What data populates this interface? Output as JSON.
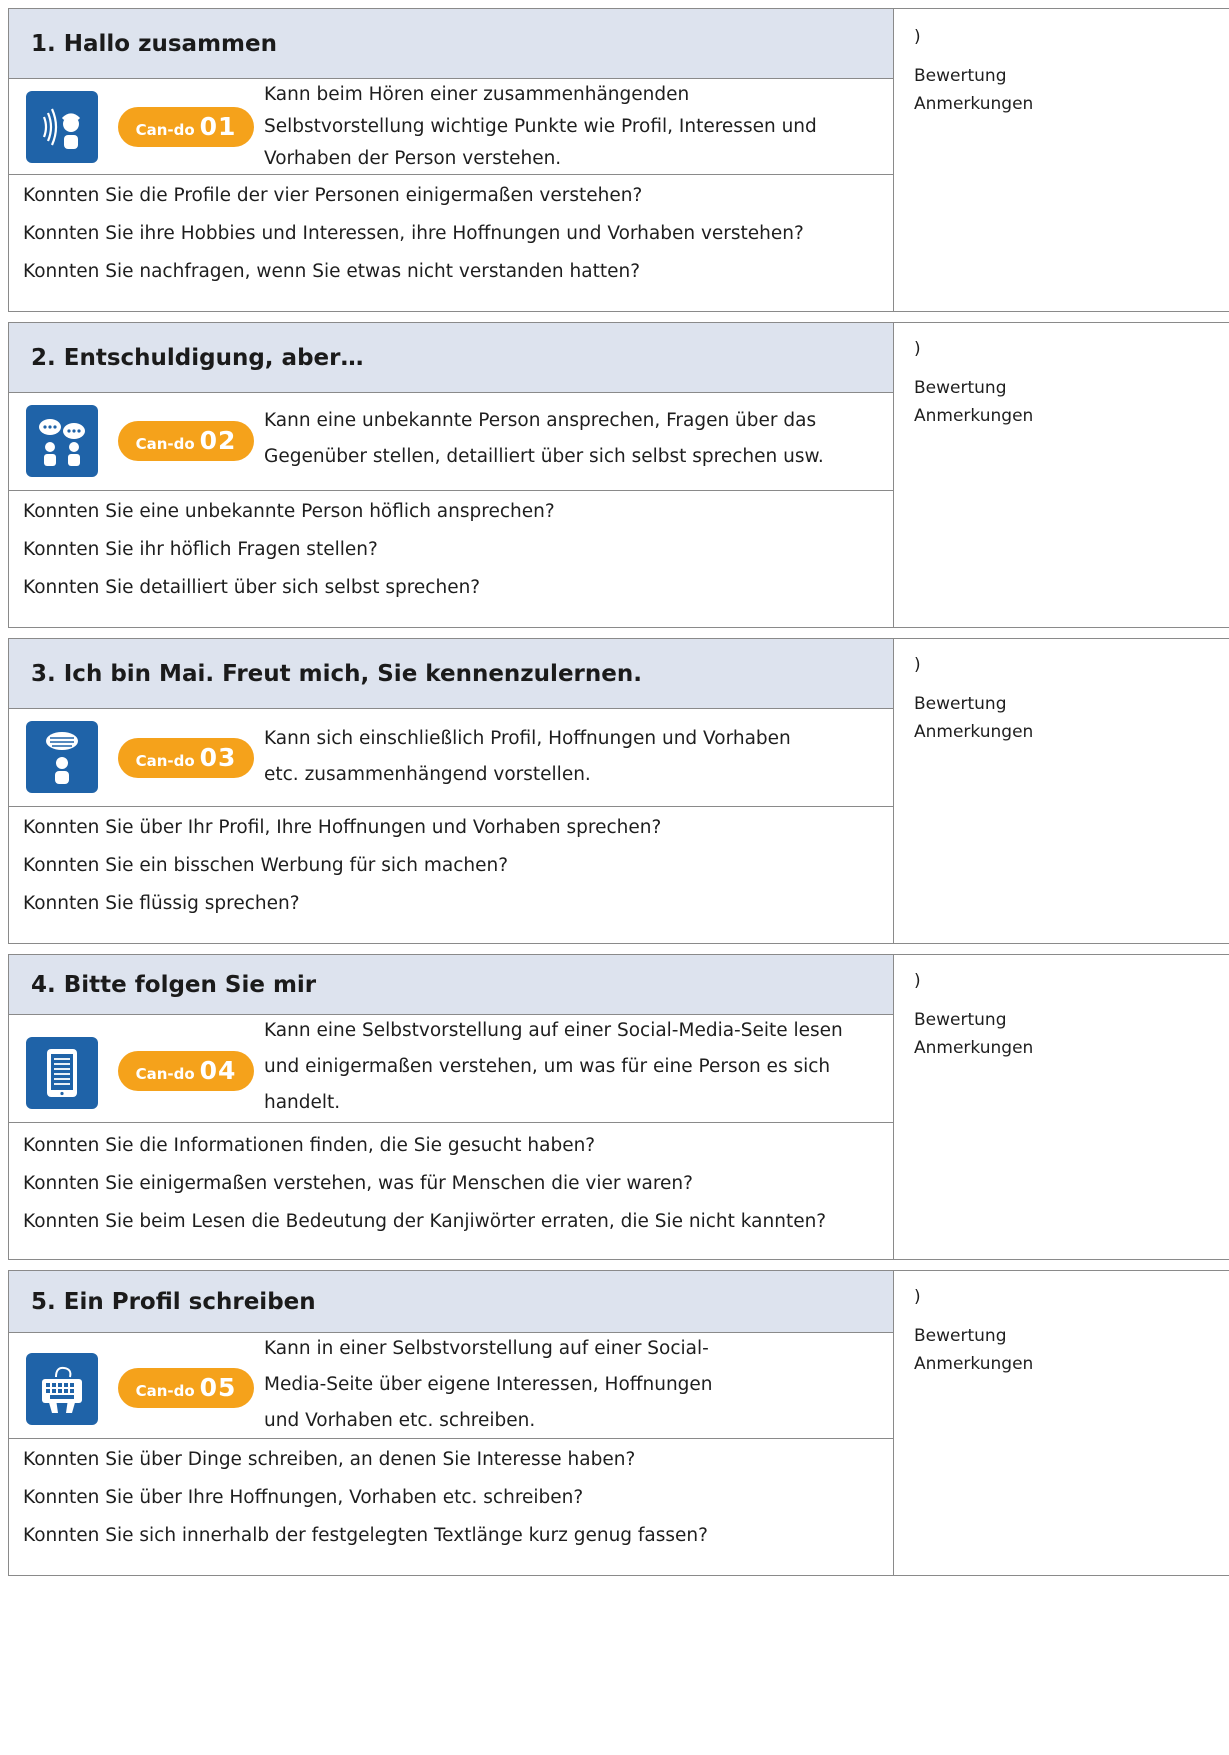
{
  "sections": [
    {
      "title": "1. Hallo zusammen",
      "icon": "listening-icon",
      "cando_label": "Can-do",
      "cando_number": "01",
      "description": [
        "Kann beim Hören einer zusammenhängenden",
        "Selbstvorstellung wichtige Punkte wie Profil,  Interessen und",
        "Vorhaben der Person verstehen."
      ],
      "questions": [
        "Konnten Sie die Profile der vier Personen einigermaßen verstehen?",
        "Konnten Sie ihre Hobbies und Interessen, ihre Hoffnungen und Vorhaben verstehen?",
        "Konnten Sie nachfragen, wenn Sie etwas nicht verstanden hatten?"
      ],
      "paren": ")",
      "rating_label": "Bewertung",
      "notes_label": "Anmerkungen"
    },
    {
      "title": "2. Entschuldigung, aber…",
      "icon": "conversation-icon",
      "cando_label": "Can-do",
      "cando_number": "02",
      "description": [
        "Kann eine unbekannte Person ansprechen, Fragen über das",
        "Gegenüber stellen, detailliert über sich selbst sprechen usw."
      ],
      "questions": [
        "Konnten Sie eine unbekannte Person höflich ansprechen?",
        "Konnten Sie ihr höflich Fragen stellen?",
        "Konnten Sie detailliert über sich selbst sprechen?"
      ],
      "paren": ")",
      "rating_label": "Bewertung",
      "notes_label": "Anmerkungen"
    },
    {
      "title": "3. Ich bin Mai. Freut mich, Sie kennenzulernen.",
      "icon": "speaking-icon",
      "cando_label": "Can-do",
      "cando_number": "03",
      "description": [
        "Kann sich  einschließlich Profil, Hoffnungen und Vorhaben",
        "etc. zusammenhängend vorstellen."
      ],
      "questions": [
        "Konnten Sie über Ihr Profil, Ihre Hoffnungen und Vorhaben sprechen?",
        "Konnten Sie ein bisschen Werbung für sich machen?",
        "Konnten Sie flüssig sprechen?"
      ],
      "paren": ")",
      "rating_label": "Bewertung",
      "notes_label": "Anmerkungen"
    },
    {
      "title": "4. Bitte folgen Sie mir",
      "icon": "reading-tablet-icon",
      "cando_label": "Can-do",
      "cando_number": "04",
      "description": [
        "Kann eine Selbstvorstellung auf einer Social-Media-Seite lesen",
        "und einigermaßen verstehen, um was für eine Person es sich",
        "handelt."
      ],
      "questions": [
        "Konnten Sie die Informationen finden, die Sie gesucht haben?",
        "Konnten Sie einigermaßen verstehen, was für Menschen die vier waren?",
        "Konnten Sie beim Lesen die Bedeutung der Kanjiwörter erraten, die Sie nicht kannten?"
      ],
      "paren": ")",
      "rating_label": "Bewertung",
      "notes_label": "Anmerkungen"
    },
    {
      "title": "5. Ein Profil schreiben",
      "icon": "writing-keyboard-icon",
      "cando_label": "Can-do",
      "cando_number": "05",
      "description": [
        "Kann in einer Selbstvorstellung auf einer Social-",
        "Media-Seite über eigene Interessen, Hoffnungen",
        "und Vorhaben etc. schreiben."
      ],
      "questions": [
        "Konnten Sie über Dinge schreiben, an denen Sie Interesse haben?",
        "Konnten Sie über Ihre Hoffnungen, Vorhaben etc. schreiben?",
        "Konnten Sie sich innerhalb der festgelegten Textlänge kurz genug fassen?"
      ],
      "paren": ")",
      "rating_label": "Bewertung",
      "notes_label": "Anmerkungen"
    }
  ]
}
